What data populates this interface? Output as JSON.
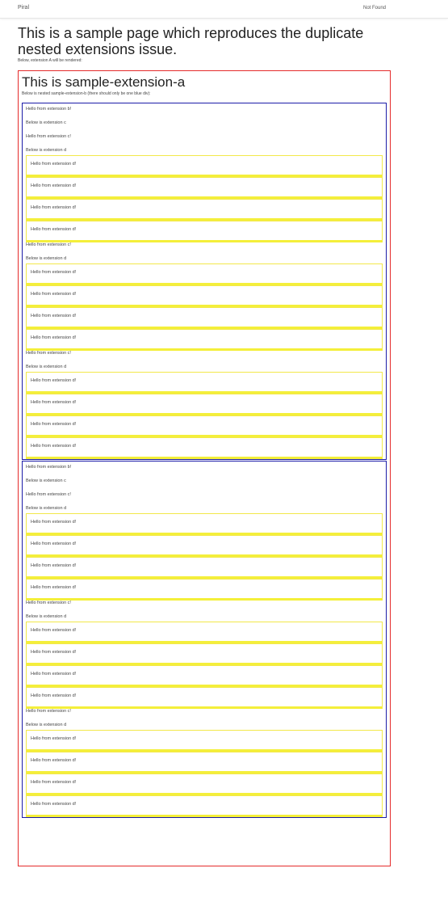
{
  "topbar": {
    "brand": "Piral",
    "nav_link": "Not Found"
  },
  "page": {
    "title": "This is a sample page which reproduces the duplicate nested extensions issue.",
    "subtitle": "Below, extension A will be rendered:"
  },
  "ext_a": {
    "title": "This is sample-extension-a",
    "note": "Below is nested sample-extension-b (there should only be one blue div):"
  },
  "ext_b": {
    "hello": "Hello from extension b!",
    "below_c": "Below is extension c"
  },
  "ext_c": {
    "hello": "Hello from extension c!",
    "below_d": "Below is extension d"
  },
  "ext_d": {
    "hello": "Hello from extension d!"
  }
}
